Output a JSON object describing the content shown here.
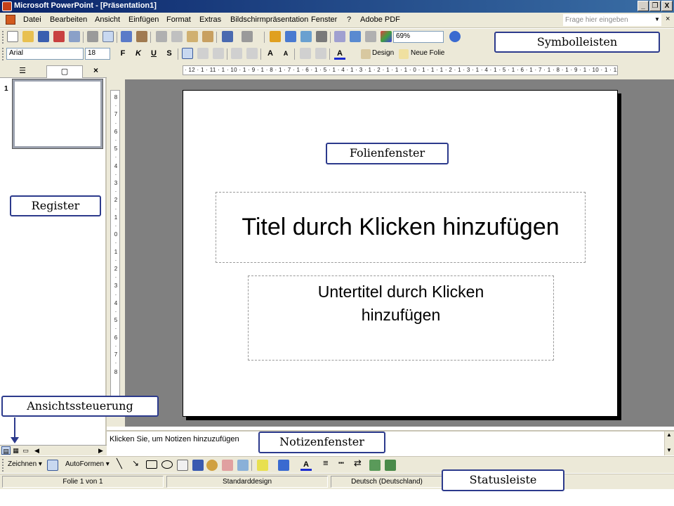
{
  "window": {
    "title": "Microsoft PowerPoint - [Präsentation1]",
    "min_glyph": "_",
    "restore_glyph": "❐",
    "close_glyph": "X"
  },
  "menu": {
    "items": [
      "Datei",
      "Bearbeiten",
      "Ansicht",
      "Einfügen",
      "Format",
      "Extras",
      "Bildschirmpräsentation",
      "Fenster",
      "?",
      "Adobe PDF"
    ],
    "help_placeholder": "Frage hier eingeben",
    "close_glyph": "×"
  },
  "toolbar": {
    "zoom": "69%",
    "font_name": "Arial",
    "font_size": "18",
    "bold": "F",
    "italic": "K",
    "underline": "U",
    "shadow": "S",
    "design_label": "Design",
    "new_slide_label": "Neue Folie",
    "font_color_glyph": "A",
    "grow_font_glyph": "A",
    "shrink_font_glyph": "A"
  },
  "left_pane": {
    "tab_outline_glyph": "☰",
    "tab_slides_glyph": "▢",
    "close_glyph": "×",
    "slide_number": "1"
  },
  "rulers": {
    "horizontal": "· 12 · 1 · 11 · 1 · 10 · 1 · 9 · 1 · 8 · 1 · 7 · 1 · 6 · 1 · 5 · 1 · 4 · 1 · 3 · 1 · 2 · 1 · 1 · 1 · 0 · 1 · 1 · 1 · 2 · 1 · 3 · 1 · 4 · 1 · 5 · 1 · 6 · 1 · 7 · 1 · 8 · 1 · 9 · 1 · 10 · 1 · 11 · 1 · 12 ·",
    "vertical": [
      "8",
      "·",
      "7",
      "·",
      "6",
      "·",
      "5",
      "·",
      "4",
      "·",
      "3",
      "·",
      "2",
      "·",
      "1",
      "·",
      "0",
      "·",
      "1",
      "·",
      "2",
      "·",
      "3",
      "·",
      "4",
      "·",
      "5",
      "·",
      "6",
      "·",
      "7",
      "·",
      "8"
    ]
  },
  "slide": {
    "title_placeholder": "Titel durch Klicken hinzufügen",
    "subtitle_placeholder": "Untertitel durch Klicken hinzufügen"
  },
  "notes": {
    "placeholder": "Klicken Sie, um Notizen hinzuzufügen",
    "scroll_up_glyph": "▲",
    "scroll_down_glyph": "▼"
  },
  "draw_toolbar": {
    "draw_label": "Zeichnen ▾",
    "autoshapes_label": "AutoFormen ▾",
    "font_color_glyph": "A"
  },
  "status": {
    "slide": "Folie 1 von 1",
    "design": "Standarddesign",
    "language": "Deutsch (Deutschland)"
  },
  "callouts": {
    "symbolleisten": "Symbolleisten",
    "folienfenster": "Folienfenster",
    "register": "Register",
    "ansichtssteuerung": "Ansichtssteuerung",
    "notizenfenster": "Notizenfenster",
    "statusleiste": "Statusleiste"
  },
  "colors": {
    "titlebar_start": "#0a246a",
    "titlebar_end": "#3a6ea5",
    "chrome": "#ece9d8",
    "workspace": "#808080",
    "callout_border": "#2c3a8c"
  }
}
